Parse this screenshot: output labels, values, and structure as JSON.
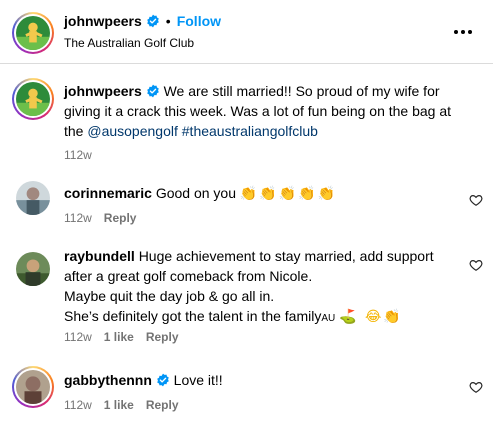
{
  "post": {
    "author": "johnwpeers",
    "follow_label": "Follow",
    "separator": "•",
    "location": "The Australian Golf Club"
  },
  "caption": {
    "author": "johnwpeers",
    "text_1": "We are still married!! So proud of my wife for giving it a crack this week. Was a lot of fun being on the bag at the ",
    "mention": "@ausopengolf",
    "hashtag": "#theaustraliangolfclub",
    "time": "112w"
  },
  "comments": [
    {
      "author": "corinnemaric",
      "text": "Good on you",
      "emojis": "👏👏👏👏👏",
      "time": "112w",
      "reply_label": "Reply"
    },
    {
      "author": "raybundell",
      "text_line1": "Huge achievement to stay married, add support after a great golf comeback from Nicole.",
      "text_line2": "Maybe quit the day job & go all in.",
      "text_line3": "She’s definitely got the talent in the family",
      "flag": "AU",
      "emojis": "⛳ 😂👏",
      "time": "112w",
      "likes": "1 like",
      "reply_label": "Reply"
    },
    {
      "author": "gabbythennn",
      "text": "Love it!!",
      "time": "112w",
      "likes": "1 like",
      "reply_label": "Reply"
    }
  ],
  "colors": {
    "accent": "#0095f6",
    "link": "#00376b",
    "muted": "#737373",
    "verified": "#0095f6"
  },
  "icons": {
    "verified": "verified-badge-icon",
    "more": "more-options-icon",
    "heart": "heart-icon"
  }
}
